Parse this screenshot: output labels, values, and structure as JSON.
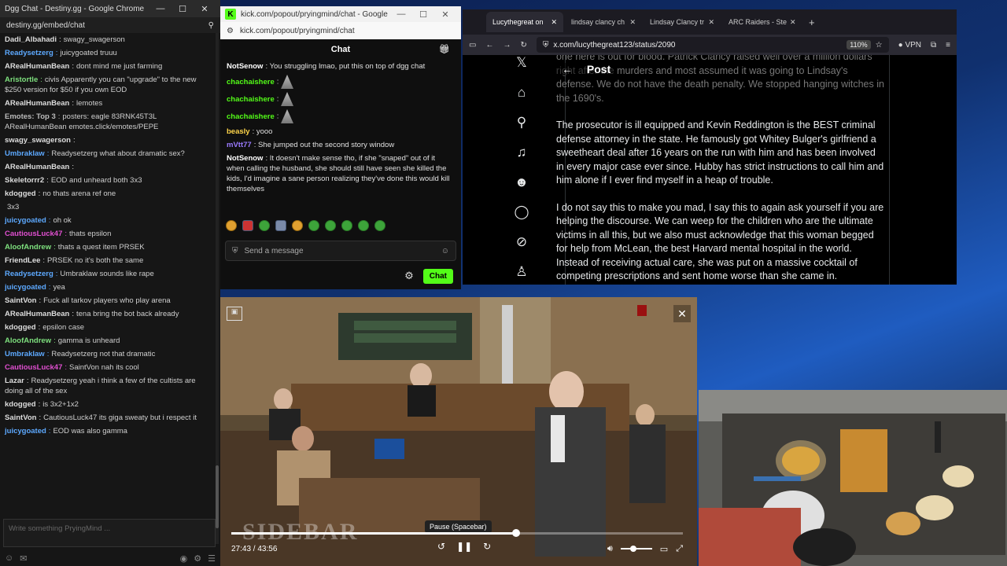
{
  "dgg": {
    "window_title": "Dgg Chat - Destiny.gg - Google Chrome",
    "url": "destiny.gg/embed/chat",
    "input_placeholder": "Write something PryingMind ...",
    "messages": [
      {
        "nick": "Dadi_Albahadi",
        "color": "#dddddd",
        "text": "swagy_swagerson"
      },
      {
        "nick": "Readysetzerg",
        "color": "#5da9ff",
        "text": "juicygoated truuu"
      },
      {
        "nick": "ARealHumanBean",
        "color": "#dddddd",
        "text": "dont mind me just farming"
      },
      {
        "nick": "Aristortle",
        "color": "#7ee07e",
        "text": "civis Apparently you can \"upgrade\" to the new $250 version for $50 if you own EOD"
      },
      {
        "nick": "ARealHumanBean",
        "color": "#dddddd",
        "text": "lemotes"
      },
      {
        "nick": "Emotes: Top 3",
        "color": "#bbbbbb",
        "text": "posters: eagle 83RNK45T3L ARealHumanBean emotes.click/emotes/PEPE"
      },
      {
        "nick": "swagy_swagerson",
        "color": "#dddddd",
        "text": ""
      },
      {
        "nick": "Umbraklaw",
        "color": "#5da9ff",
        "text": "Readysetzerg what about dramatic sex?"
      },
      {
        "nick": "ARealHumanBean",
        "color": "#dddddd",
        "text": ""
      },
      {
        "nick": "Skeletorrr2",
        "color": "#dddddd",
        "text": "EOD and unheard both 3x3"
      },
      {
        "nick": "kdogged",
        "color": "#dddddd",
        "text": "no thats arena ref one"
      },
      {
        "nick": "",
        "color": "#dddddd",
        "text": "3x3"
      },
      {
        "nick": "juicygoated",
        "color": "#5da9ff",
        "text": "oh ok"
      },
      {
        "nick": "CautiousLuck47",
        "color": "#e04fd0",
        "text": "thats epsilon"
      },
      {
        "nick": "AloofAndrew",
        "color": "#7ee07e",
        "text": "thats a quest item PRSEK"
      },
      {
        "nick": "FriendLee",
        "color": "#dddddd",
        "text": "PRSEK no it's both the same"
      },
      {
        "nick": "Readysetzerg",
        "color": "#5da9ff",
        "text": "Umbraklaw sounds like rape"
      },
      {
        "nick": "juicygoated",
        "color": "#5da9ff",
        "text": "yea"
      },
      {
        "nick": "SaintVon",
        "color": "#dddddd",
        "text": "Fuck all tarkov players who play arena"
      },
      {
        "nick": "ARealHumanBean",
        "color": "#dddddd",
        "text": "tena bring the bot back already"
      },
      {
        "nick": "kdogged",
        "color": "#dddddd",
        "text": "epsilon case"
      },
      {
        "nick": "AloofAndrew",
        "color": "#7ee07e",
        "text": "gamma is unheard"
      },
      {
        "nick": "Umbraklaw",
        "color": "#5da9ff",
        "text": "Readysetzerg not that dramatic"
      },
      {
        "nick": "CautiousLuck47",
        "color": "#e04fd0",
        "text": "SaintVon nah its cool"
      },
      {
        "nick": "Lazar",
        "color": "#dddddd",
        "text": "Readysetzerg yeah i think a few of the cultists are doing all of the sex"
      },
      {
        "nick": "kdogged",
        "color": "#dddddd",
        "text": "is 3x2+1x2"
      },
      {
        "nick": "SaintVon",
        "color": "#dddddd",
        "text": "CautiousLuck47 its giga sweaty but i respect it"
      },
      {
        "nick": "juicygoated",
        "color": "#5da9ff",
        "text": "EOD was also gamma"
      }
    ]
  },
  "kick": {
    "window_title": "kick.com/popout/pryingmind/chat - Google Chrome",
    "url": "kick.com/popout/pryingmind/chat",
    "header": "Chat",
    "input_placeholder": "Send a message",
    "send_label": "Chat",
    "messages": [
      {
        "nick": "NotSenow",
        "style": "white",
        "text": "You struggling lmao, put this on top of dgg chat"
      },
      {
        "nick": "chachaishere",
        "style": "green",
        "text": ""
      },
      {
        "nick": "chachaishere",
        "style": "green",
        "text": ""
      },
      {
        "nick": "chachaishere",
        "style": "green",
        "text": ""
      },
      {
        "nick": "beasly",
        "style": "yellow",
        "text": "yooo"
      },
      {
        "nick": "mVtt77",
        "style": "purple",
        "text": "She jumped out the second story window"
      },
      {
        "nick": "NotSenow",
        "style": "white",
        "text": "It doesn't make sense tho, if she \"snaped\" out of it when calling the husband, she should still have seen she killed the kids, I'd imagine a sane person realizing they've done this would kill themselves"
      }
    ]
  },
  "x": {
    "tabs": [
      {
        "label": "Lucythegreat on",
        "active": true
      },
      {
        "label": "lindsay clancy ch",
        "active": false
      },
      {
        "label": "Lindsay Clancy tr",
        "active": false
      },
      {
        "label": "ARC Raiders - Ste",
        "active": false
      }
    ],
    "url": "x.com/lucythegreat123/status/2090",
    "zoom": "110%",
    "vpn_label": "VPN",
    "post_header": "Post",
    "paragraphs": [
      "one here is out for blood. Patrick Clancy raised well over a million dollars right after the murders and most assumed it was going to Lindsay's defense. We do not have the death penalty. We stopped hanging witches in the 1690's.",
      "The prosecutor is ill equipped and Kevin Reddington is the BEST criminal defense attorney in the state. He famously got Whitey Bulger's girlfriend a sweetheart deal after 16 years on the run with him and has been involved in every major case ever since. Hubby has strict instructions to call him and him alone if I ever find myself in a heap of trouble.",
      "I do not say this to make you mad, I say this to again ask yourself if you are helping the discourse. We can weep for the children who are the ultimate victims in all this, but we also must acknowledge that this woman begged for help from McLean, the best Harvard mental hospital in the world. Instead of receiving actual care, she was put on a massive cocktail of competing prescriptions and sent home worse than she came in."
    ]
  },
  "video": {
    "logo": "SIDEBAR",
    "tooltip": "Pause (Spacebar)",
    "time": "27:43 / 43:56",
    "progress": 0.631,
    "volume": 0.4
  }
}
